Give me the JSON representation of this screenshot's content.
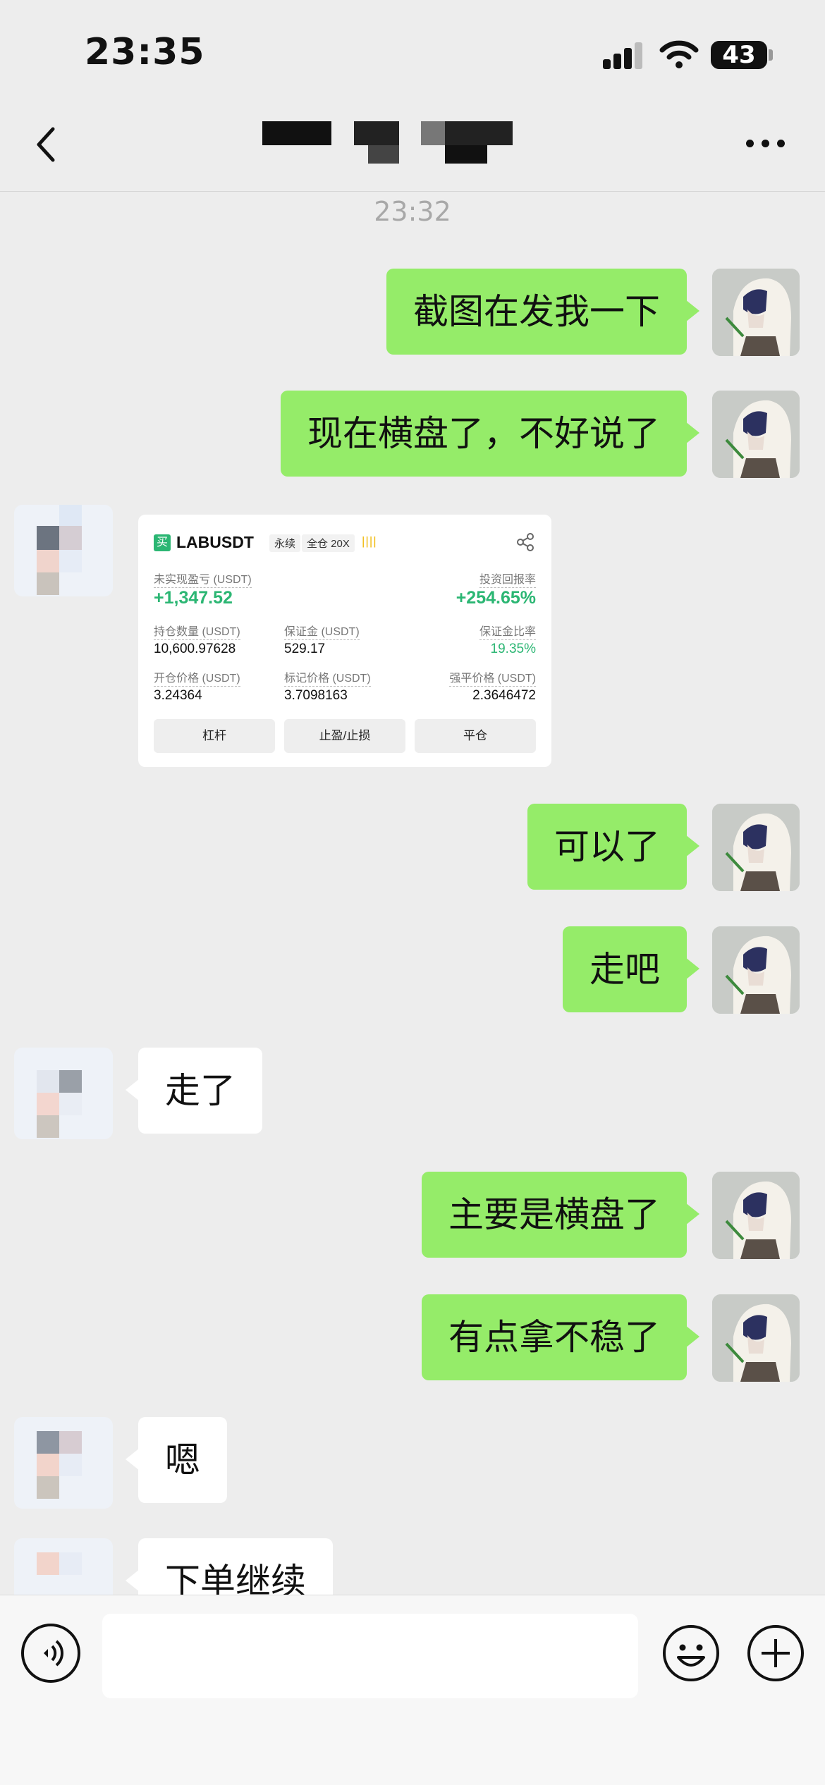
{
  "status_bar": {
    "time": "23:35",
    "battery": "43"
  },
  "chat": {
    "timestamp": "23:32",
    "messages": [
      {
        "from": "self",
        "text": "截图在发我一下"
      },
      {
        "from": "self",
        "text": "现在横盘了，不好说了"
      },
      {
        "from": "other",
        "type": "image",
        "text": ""
      },
      {
        "from": "self",
        "text": "可以了"
      },
      {
        "from": "self",
        "text": "走吧"
      },
      {
        "from": "other",
        "text": "走了"
      },
      {
        "from": "self",
        "text": "主要是横盘了"
      },
      {
        "from": "self",
        "text": "有点拿不稳了"
      },
      {
        "from": "other",
        "text": "嗯"
      },
      {
        "from": "other",
        "text": "下单继续"
      }
    ]
  },
  "trade_card": {
    "side_badge": "买",
    "symbol": "LABUSDT",
    "tag_perpetual": "永续",
    "tag_margin": "全仓 20X",
    "bars": "||||",
    "unrealized_pnl_label": "未实现盈亏 (USDT)",
    "unrealized_pnl_value": "+1,347.52",
    "roi_label": "投资回报率",
    "roi_value": "+254.65%",
    "position_qty_label": "持仓数量 (USDT)",
    "position_qty_value": "10,600.97628",
    "margin_label": "保证金 (USDT)",
    "margin_value": "529.17",
    "margin_ratio_label": "保证金比率",
    "margin_ratio_value": "19.35%",
    "entry_price_label": "开仓价格 (USDT)",
    "entry_price_value": "3.24364",
    "mark_price_label": "标记价格 (USDT)",
    "mark_price_value": "3.7098163",
    "liq_price_label": "强平价格 (USDT)",
    "liq_price_value": "2.3646472",
    "btn_leverage": "杠杆",
    "btn_tpsl": "止盈/止损",
    "btn_close": "平仓"
  },
  "colors": {
    "self_bubble": "#95ec69",
    "other_bubble": "#ffffff",
    "background": "#ededed",
    "profit_green": "#2bb673"
  },
  "icons": [
    "back-icon",
    "more-icon",
    "voice-icon",
    "emoji-icon",
    "plus-icon",
    "share-icon",
    "wifi-icon",
    "signal-icon",
    "battery-icon"
  ]
}
